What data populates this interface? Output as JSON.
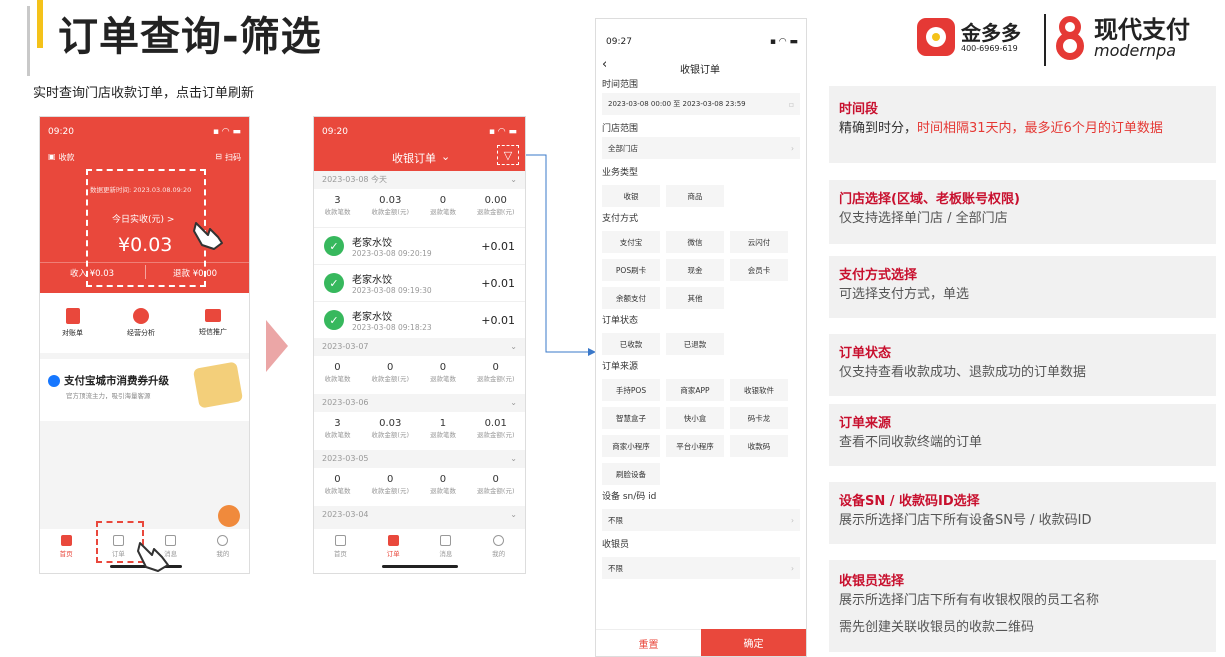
{
  "header": {
    "title": "订单查询-筛选",
    "subtitle": "实时查询门店收款订单，点击订单刷新"
  },
  "logos": {
    "brand1_name": "金多多",
    "brand1_phone": "400-6969-619",
    "brand2_name": "现代支付",
    "brand2_sub": "modernpa"
  },
  "phone1": {
    "time": "09:20",
    "collect_label": "收款",
    "scan_label": "扫码",
    "update_time": "数据更新时间: 2023.03.08.09:20",
    "today_label": "今日实收(元) >",
    "today_amount": "¥0.03",
    "income": "收入 ¥0.03",
    "refund": "退款 ¥0.00",
    "quick": [
      "对账单",
      "经营分析",
      "短信推广"
    ],
    "banner_title": "支付宝城市消费券升级",
    "banner_sub": "官方顶流主力，吸引海量客源",
    "tabs": [
      "首页",
      "订单",
      "消息",
      "我的"
    ]
  },
  "phone2": {
    "time": "09:20",
    "nav_title": "收银订单",
    "groups": [
      {
        "date": "2023-03-08 今天",
        "stats": [
          "3",
          "0.03",
          "0",
          "0.00"
        ]
      },
      {
        "date": "2023-03-07",
        "stats": [
          "0",
          "0",
          "0",
          "0"
        ]
      },
      {
        "date": "2023-03-06",
        "stats": [
          "3",
          "0.03",
          "1",
          "0.01"
        ]
      },
      {
        "date": "2023-03-05",
        "stats": [
          "0",
          "0",
          "0",
          "0"
        ]
      },
      {
        "date": "2023-03-04",
        "stats": []
      }
    ],
    "stat_labels": [
      "收款笔数",
      "收款金额(元)",
      "退款笔数",
      "退款金额(元)"
    ],
    "orders": [
      {
        "name": "老家水饺",
        "time": "2023-03-08 09:20:19",
        "amount": "+0.01"
      },
      {
        "name": "老家水饺",
        "time": "2023-03-08 09:19:30",
        "amount": "+0.01"
      },
      {
        "name": "老家水饺",
        "time": "2023-03-08 09:18:23",
        "amount": "+0.01"
      }
    ],
    "tabs": [
      "首页",
      "订单",
      "消息",
      "我的"
    ]
  },
  "phone3": {
    "time": "09:27",
    "nav_title": "收银订单",
    "time_range_label": "时间范围",
    "time_range_value": "2023-03-08 00:00 至 2023-03-08 23:59",
    "store_label": "门店范围",
    "store_value": "全部门店",
    "biz_label": "业务类型",
    "biz_options": [
      "收银",
      "商品"
    ],
    "pay_label": "支付方式",
    "pay_options": [
      "支付宝",
      "微信",
      "云闪付",
      "POS刷卡",
      "现金",
      "会员卡",
      "余额支付",
      "其他"
    ],
    "status_label": "订单状态",
    "status_options": [
      "已收款",
      "已退款"
    ],
    "source_label": "订单来源",
    "source_options": [
      "手持POS",
      "商家APP",
      "收银软件",
      "智慧盒子",
      "快小盒",
      "码卡龙",
      "商家小程序",
      "平台小程序",
      "收款码",
      "刷脸设备"
    ],
    "device_label": "设备 sn/码 id",
    "device_value": "不限",
    "cashier_label": "收银员",
    "cashier_value": "不限",
    "reset": "重置",
    "confirm": "确定"
  },
  "panels": [
    {
      "head": "时间段",
      "body_pre": "精确到时分，",
      "body_hl": "时间相隔31天内，最多近6个月的订单数据"
    },
    {
      "head": "门店选择(区域、老板账号权限)",
      "body": "仅支持选择单门店 / 全部门店"
    },
    {
      "head": "支付方式选择",
      "body": "可选择支付方式，单选"
    },
    {
      "head": "订单状态",
      "body": "仅支持查看收款成功、退款成功的订单数据"
    },
    {
      "head": "订单来源",
      "body": "查看不同收款终端的订单"
    },
    {
      "head": "设备SN / 收款码ID选择",
      "body": "展示所选择门店下所有设备SN号 / 收款码ID"
    },
    {
      "head": "收银员选择",
      "body": "展示所选择门店下所有有收银权限的员工名称",
      "body2": "需先创建关联收银员的收款二维码"
    }
  ],
  "colors": {
    "primary_red": "#e9483c",
    "panel_head": "#c8102e",
    "accent_yellow": "#f4c21a"
  }
}
